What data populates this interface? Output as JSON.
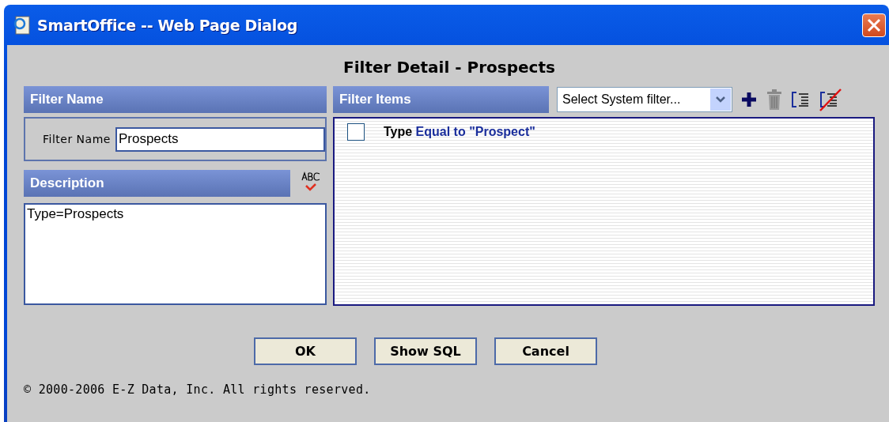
{
  "window": {
    "title": "SmartOffice -- Web Page Dialog"
  },
  "heading": "Filter Detail - Prospects",
  "filter_name_panel": {
    "header": "Filter Name",
    "label": "Filter Name",
    "value": "Prospects"
  },
  "description_panel": {
    "header": "Description",
    "value": "Type=Prospects"
  },
  "filter_items_panel": {
    "header": "Filter Items",
    "system_filter": "Select System filter...",
    "items": [
      {
        "field": "Type",
        "condition": "Equal to \"Prospect\"",
        "checked": false
      }
    ]
  },
  "buttons": [
    "OK",
    "Show SQL",
    "Cancel"
  ],
  "footer": "© 2000-2006 E-Z Data, Inc. All rights reserved."
}
